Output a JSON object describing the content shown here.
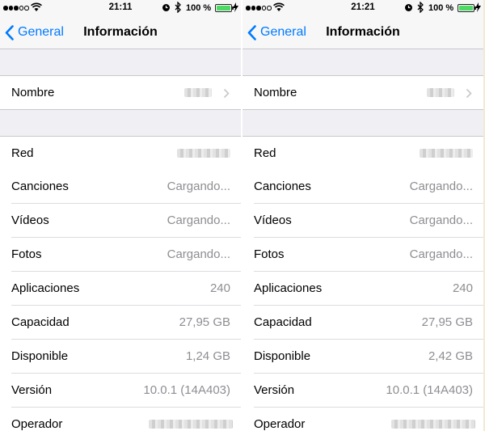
{
  "colors": {
    "accent": "#007aff",
    "battery": "#4cd964",
    "secondary_text": "#8e8e93",
    "group_background": "#efeff4"
  },
  "screens": [
    {
      "status": {
        "time": "21:11",
        "battery_pct": "100 %"
      },
      "nav": {
        "back_label": "General",
        "title": "Información"
      },
      "name": {
        "label": "Nombre"
      },
      "rows": [
        {
          "label": "Red",
          "value": "",
          "redacted": true
        },
        {
          "label": "Canciones",
          "value": "Cargando..."
        },
        {
          "label": "Vídeos",
          "value": "Cargando..."
        },
        {
          "label": "Fotos",
          "value": "Cargando..."
        },
        {
          "label": "Aplicaciones",
          "value": "240"
        },
        {
          "label": "Capacidad",
          "value": "27,95 GB"
        },
        {
          "label": "Disponible",
          "value": "1,24 GB"
        },
        {
          "label": "Versión",
          "value": "10.0.1 (14A403)"
        },
        {
          "label": "Operador",
          "value": "",
          "redacted": true
        }
      ]
    },
    {
      "status": {
        "time": "21:21",
        "battery_pct": "100 %"
      },
      "nav": {
        "back_label": "General",
        "title": "Información"
      },
      "name": {
        "label": "Nombre"
      },
      "rows": [
        {
          "label": "Red",
          "value": "",
          "redacted": true
        },
        {
          "label": "Canciones",
          "value": "Cargando..."
        },
        {
          "label": "Vídeos",
          "value": "Cargando..."
        },
        {
          "label": "Fotos",
          "value": "Cargando..."
        },
        {
          "label": "Aplicaciones",
          "value": "240"
        },
        {
          "label": "Capacidad",
          "value": "27,95 GB"
        },
        {
          "label": "Disponible",
          "value": "2,42 GB"
        },
        {
          "label": "Versión",
          "value": "10.0.1 (14A403)"
        },
        {
          "label": "Operador",
          "value": "",
          "redacted": true
        }
      ]
    }
  ]
}
